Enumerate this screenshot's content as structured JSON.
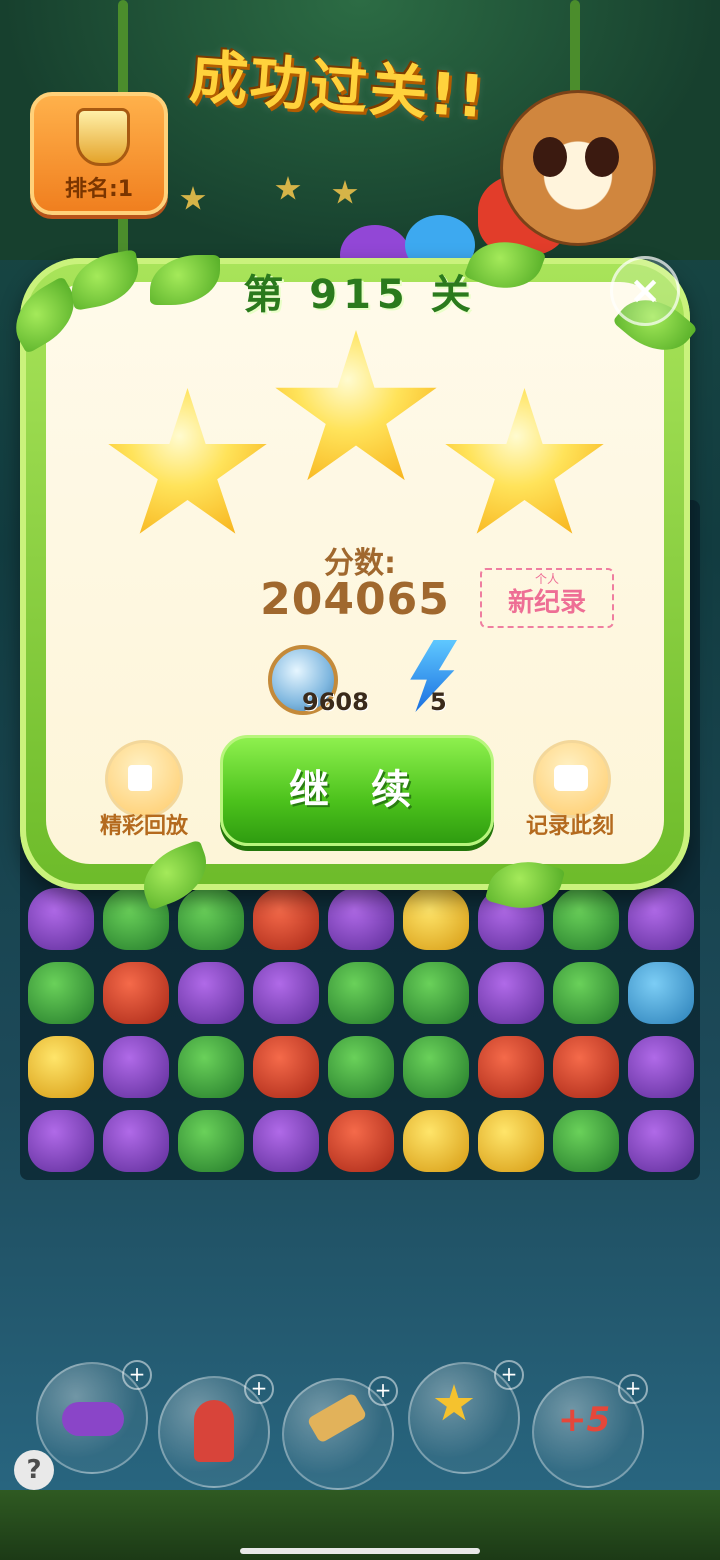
{
  "header": {
    "rank_label": "排名:1",
    "headline": "成功过关!!"
  },
  "dialog": {
    "level_title": "第 915 关",
    "stars_earned": 3,
    "stars_total": 3,
    "score_label": "分数:",
    "score_value": "204065",
    "record_small": "个人",
    "record_big": "新纪录",
    "coin_count": "9608",
    "energy_count": "5",
    "continue_label": "继 续",
    "replay_label": "精彩回放",
    "record_moment_label": "记录此刻",
    "close_symbol": "×"
  },
  "tools": {
    "booster_5_label": "+5"
  },
  "help_symbol": "?",
  "icons": [
    "rank-shield-icon",
    "close-icon",
    "star-icon",
    "coin-icon",
    "lightning-icon",
    "video-icon",
    "camera-icon",
    "rocket-icon",
    "hammer-icon",
    "magic-wand-icon",
    "plus-icon",
    "help-icon"
  ],
  "colors": {
    "accent_green": "#4cc21c",
    "star_gold": "#f7b21a",
    "score_brown": "#a0682e",
    "record_pink": "#ee6e95"
  }
}
